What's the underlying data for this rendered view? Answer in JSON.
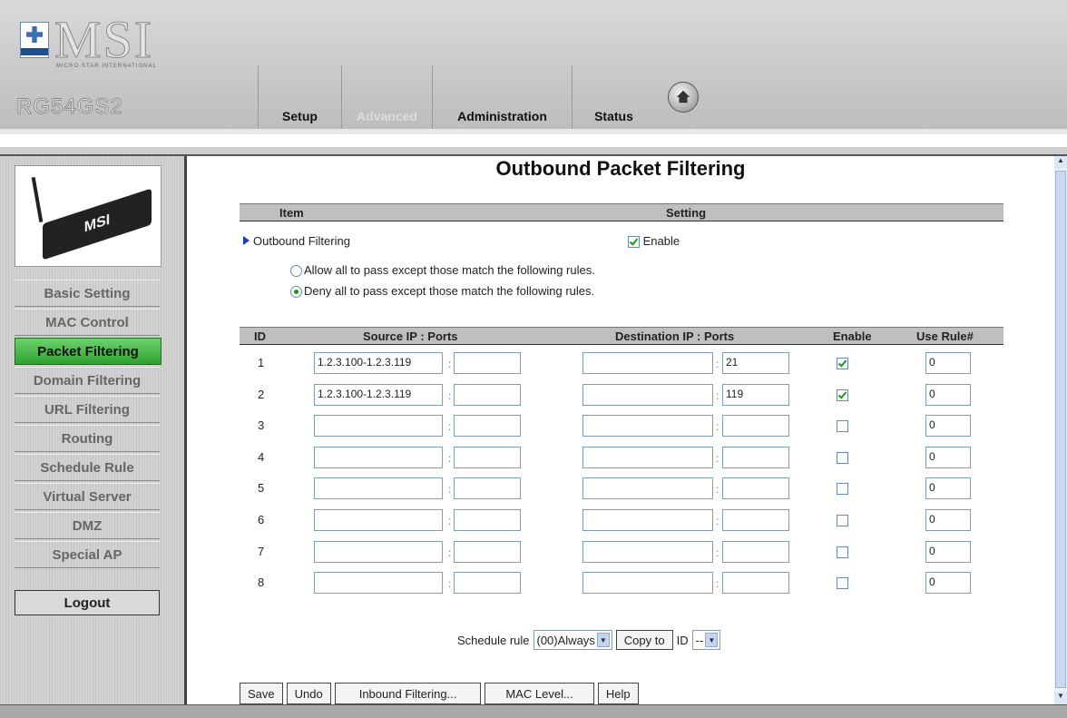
{
  "header": {
    "brand": "MSI",
    "brand_sub": "MICRO-STAR INTERNATIONAL",
    "model": "RG54GS2",
    "tabs": [
      {
        "label": "Setup"
      },
      {
        "label": "Advanced"
      },
      {
        "label": "Administration"
      },
      {
        "label": "Status"
      }
    ],
    "active_tab": "Advanced",
    "home_icon": "home-icon"
  },
  "sidebar": {
    "device_label": "MSI",
    "items": [
      {
        "label": "Basic Setting"
      },
      {
        "label": "MAC Control"
      },
      {
        "label": "Packet Filtering"
      },
      {
        "label": "Domain Filtering"
      },
      {
        "label": "URL Filtering"
      },
      {
        "label": "Routing"
      },
      {
        "label": "Schedule Rule"
      },
      {
        "label": "Virtual Server"
      },
      {
        "label": "DMZ"
      },
      {
        "label": "Special AP"
      }
    ],
    "active_item": "Packet Filtering",
    "logout_label": "Logout"
  },
  "main": {
    "title": "Outbound Packet Filtering",
    "settings_header": {
      "item": "Item",
      "setting": "Setting"
    },
    "outbound_filtering_label": "Outbound Filtering",
    "enable_label": "Enable",
    "enable_checked": true,
    "radio_options": [
      {
        "label": "Allow all to pass except those match the following rules.",
        "selected": false
      },
      {
        "label": "Deny all to pass except those match the following rules.",
        "selected": true
      }
    ],
    "table": {
      "columns": [
        "ID",
        "Source IP : Ports",
        "Destination IP : Ports",
        "Enable",
        "Use Rule#"
      ],
      "rows": [
        {
          "id": "1",
          "src_ip": "1.2.3.100-1.2.3.119",
          "src_port": "",
          "dst_ip": "",
          "dst_port": "21",
          "enable": true,
          "rule": "0"
        },
        {
          "id": "2",
          "src_ip": "1.2.3.100-1.2.3.119",
          "src_port": "",
          "dst_ip": "",
          "dst_port": "119",
          "enable": true,
          "rule": "0"
        },
        {
          "id": "3",
          "src_ip": "",
          "src_port": "",
          "dst_ip": "",
          "dst_port": "",
          "enable": false,
          "rule": "0"
        },
        {
          "id": "4",
          "src_ip": "",
          "src_port": "",
          "dst_ip": "",
          "dst_port": "",
          "enable": false,
          "rule": "0"
        },
        {
          "id": "5",
          "src_ip": "",
          "src_port": "",
          "dst_ip": "",
          "dst_port": "",
          "enable": false,
          "rule": "0"
        },
        {
          "id": "6",
          "src_ip": "",
          "src_port": "",
          "dst_ip": "",
          "dst_port": "",
          "enable": false,
          "rule": "0"
        },
        {
          "id": "7",
          "src_ip": "",
          "src_port": "",
          "dst_ip": "",
          "dst_port": "",
          "enable": false,
          "rule": "0"
        },
        {
          "id": "8",
          "src_ip": "",
          "src_port": "",
          "dst_ip": "",
          "dst_port": "",
          "enable": false,
          "rule": "0"
        }
      ]
    },
    "schedule": {
      "label": "Schedule rule",
      "selected": "(00)Always",
      "copy_label": "Copy to",
      "id_label": "ID",
      "id_selected": "--"
    },
    "buttons": {
      "save": "Save",
      "undo": "Undo",
      "inbound": "Inbound Filtering...",
      "mac_level": "MAC Level...",
      "help": "Help"
    }
  },
  "colors": {
    "active_menu": "#3cb43c",
    "header_bg": "#c9c9c9",
    "table_header": "#bfbfbf"
  }
}
